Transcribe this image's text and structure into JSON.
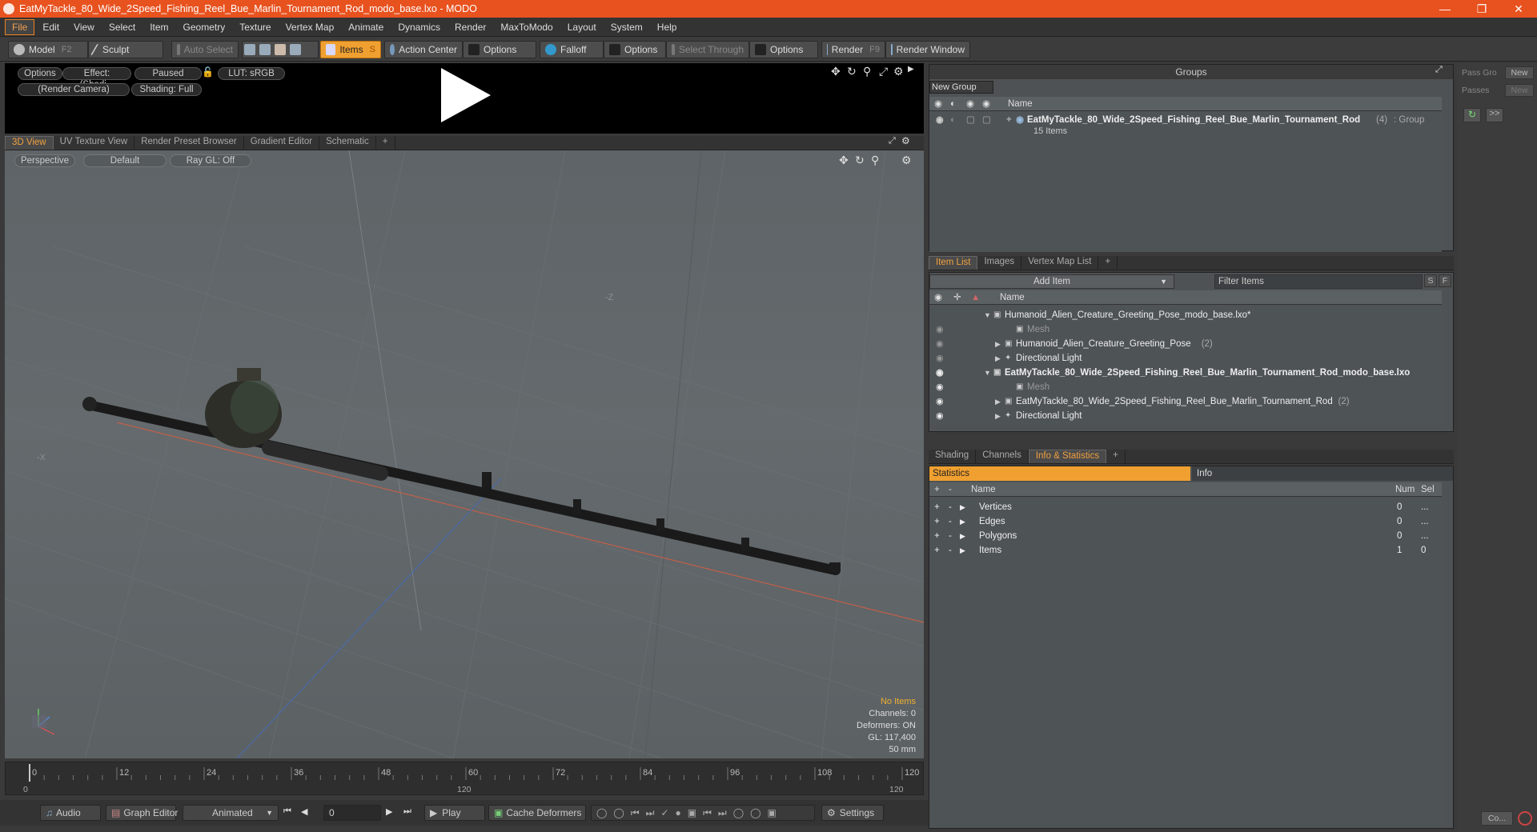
{
  "window": {
    "title": "EatMyTackle_80_Wide_2Speed_Fishing_Reel_Bue_Marlin_Tournament_Rod_modo_base.lxo - MODO"
  },
  "menu": [
    "File",
    "Edit",
    "View",
    "Select",
    "Item",
    "Geometry",
    "Texture",
    "Vertex Map",
    "Animate",
    "Dynamics",
    "Render",
    "MaxToModo",
    "Layout",
    "System",
    "Help"
  ],
  "toolbar": {
    "model": "Model",
    "model_key": "F2",
    "sculpt": "Sculpt",
    "auto_select": "Auto Select",
    "items": "Items",
    "items_key": "S",
    "action_center": "Action Center",
    "options1": "Options",
    "falloff": "Falloff",
    "options2": "Options",
    "select_through": "Select Through",
    "options3": "Options",
    "render": "Render",
    "render_key": "F9",
    "render_window": "Render Window"
  },
  "preview": {
    "options": "Options",
    "effect": "Effect: (Shadi...",
    "paused": "Paused",
    "lut": "LUT: sRGB",
    "camera": "(Render Camera)",
    "shading": "Shading: Full"
  },
  "view_tabs": [
    "3D View",
    "UV Texture View",
    "Render Preset Browser",
    "Gradient Editor",
    "Schematic",
    "+"
  ],
  "viewport": {
    "perspective": "Perspective",
    "default": "Default",
    "raygl": "Ray GL: Off",
    "axis_z": "-Z",
    "axis_x": "-X",
    "status": {
      "items": "No Items",
      "channels": "Channels: 0",
      "deformers": "Deformers: ON",
      "gl": "GL: 117,400",
      "lens": "50 mm"
    }
  },
  "timeline": {
    "ticks": [
      "0",
      "12",
      "24",
      "36",
      "48",
      "60",
      "72",
      "84",
      "96",
      "108",
      "120"
    ],
    "range_start": "0",
    "range_mid": "120",
    "range_end": "120"
  },
  "bottom": {
    "audio": "Audio",
    "graph_editor": "Graph Editor",
    "animated": "Animated",
    "frame": "0",
    "play": "Play",
    "cache": "Cache Deformers",
    "settings": "Settings"
  },
  "groups": {
    "title": "Groups",
    "new_group": "New Group",
    "col_name": "Name",
    "item_name": "EatMyTackle_80_Wide_2Speed_Fishing_Reel_Bue_Marlin_Tournament_Rod",
    "item_count": "(4)",
    "item_type": ": Group",
    "item_sub": "15 Items",
    "pass_label": "Pass Gro",
    "passes_label": "Passes",
    "new1": "New",
    "new2": "New"
  },
  "itemlist": {
    "tabs": [
      "Item List",
      "Images",
      "Vertex Map List",
      "+"
    ],
    "add_item": "Add Item",
    "filter": "Filter Items",
    "s": "S",
    "f": "F",
    "col_name": "Name",
    "rows": [
      {
        "text": "Humanoid_Alien_Creature_Greeting_Pose_modo_base.lxo*",
        "extra": "",
        "bold": false,
        "indent": 0,
        "dim": false
      },
      {
        "text": "Mesh",
        "extra": "",
        "bold": false,
        "indent": 2,
        "dim": true
      },
      {
        "text": "Humanoid_Alien_Creature_Greeting_Pose",
        "extra": "(2)",
        "bold": false,
        "indent": 1,
        "dim": false
      },
      {
        "text": "Directional Light",
        "extra": "",
        "bold": false,
        "indent": 1,
        "dim": false
      },
      {
        "text": "EatMyTackle_80_Wide_2Speed_Fishing_Reel_Bue_Marlin_Tournament_Rod_modo_base.lxo",
        "extra": "",
        "bold": true,
        "indent": 0,
        "dim": false
      },
      {
        "text": "Mesh",
        "extra": "",
        "bold": false,
        "indent": 2,
        "dim": true
      },
      {
        "text": "EatMyTackle_80_Wide_2Speed_Fishing_Reel_Bue_Marlin_Tournament_Rod",
        "extra": "(2)",
        "bold": false,
        "indent": 1,
        "dim": false
      },
      {
        "text": "Directional Light",
        "extra": "",
        "bold": false,
        "indent": 1,
        "dim": false
      }
    ]
  },
  "stats": {
    "tabs": [
      "Shading",
      "Channels",
      "Info & Statistics",
      "+"
    ],
    "statistics": "Statistics",
    "info": "Info",
    "col_name": "Name",
    "col_num": "Num",
    "col_sel": "Sel",
    "rows": [
      {
        "name": "Vertices",
        "num": "0",
        "sel": "..."
      },
      {
        "name": "Edges",
        "num": "0",
        "sel": "..."
      },
      {
        "name": "Polygons",
        "num": "0",
        "sel": "..."
      },
      {
        "name": "Items",
        "num": "1",
        "sel": "0"
      }
    ]
  },
  "right": {
    "more": ">>",
    "co": "Co..."
  }
}
